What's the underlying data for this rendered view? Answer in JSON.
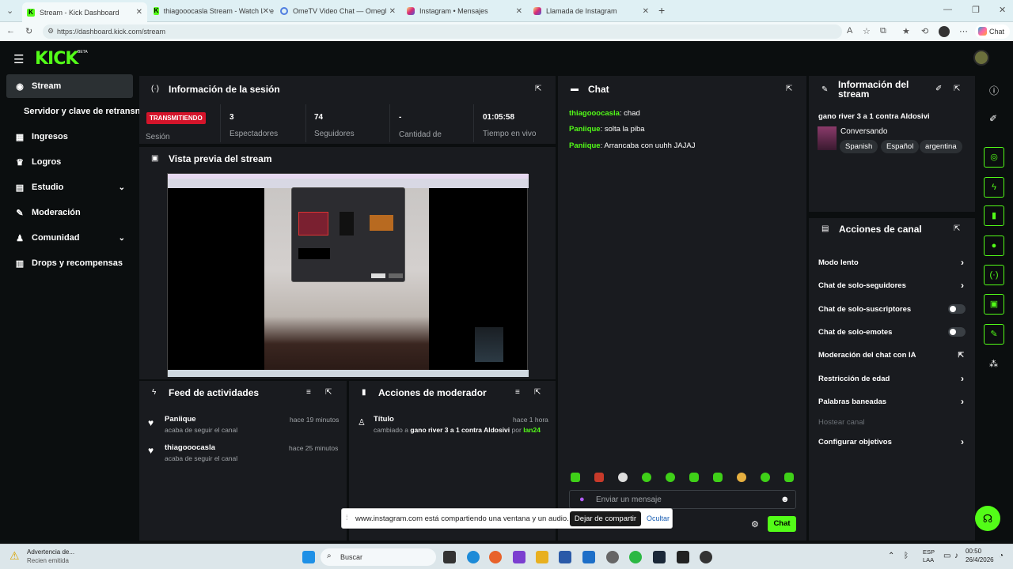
{
  "browser": {
    "tabs": [
      {
        "label": "Stream - Kick Dashboard"
      },
      {
        "label": "thiagooocasla Stream - Watch Live"
      },
      {
        "label": "OmeTV Video Chat — Omegl"
      },
      {
        "label": "Instagram • Mensajes"
      },
      {
        "label": "Llamada de Instagram"
      }
    ],
    "url": "https://dashboard.kick.com/stream",
    "chat_button": "Chat"
  },
  "app": {
    "logo": "KICK",
    "logo_tag": "BETA"
  },
  "sidebar": {
    "items": [
      {
        "label": "Stream"
      },
      {
        "label": "Servidor y clave de retransn"
      },
      {
        "label": "Ingresos"
      },
      {
        "label": "Logros"
      },
      {
        "label": "Estudio"
      },
      {
        "label": "Moderación"
      },
      {
        "label": "Comunidad"
      },
      {
        "label": "Drops y recompensas"
      }
    ]
  },
  "session": {
    "title": "Información de la sesión",
    "status": "TRANSMITIENDO",
    "session_label": "Sesión",
    "stats": [
      {
        "value": "3",
        "label": "Espectadores"
      },
      {
        "value": "74",
        "label": "Seguidores"
      },
      {
        "value": "-",
        "label": "Cantidad de suscripciones"
      },
      {
        "value": "01:05:58",
        "label": "Tiempo en vivo"
      }
    ]
  },
  "preview": {
    "title": "Vista previa del stream"
  },
  "chat": {
    "title": "Chat",
    "messages": [
      {
        "user": "thiagooocasla",
        "text": "chad"
      },
      {
        "user": "Paniique",
        "text": "solta la piba"
      },
      {
        "user": "Paniique",
        "text": "Arrancaba con uuhh JAJAJ"
      }
    ],
    "input_placeholder": "Enviar un mensaje",
    "send_label": "Chat"
  },
  "stream_info": {
    "title": "Información del stream",
    "stream_title": "gano river 3 a 1 contra Aldosivi",
    "category": "Conversando",
    "tags": [
      "Spanish",
      "Español",
      "argentina"
    ]
  },
  "channel_actions": {
    "title": "Acciones de canal",
    "items": [
      {
        "label": "Modo lento"
      },
      {
        "label": "Chat de solo-seguidores"
      },
      {
        "label": "Chat de solo-suscriptores"
      },
      {
        "label": "Chat de solo-emotes"
      },
      {
        "label": "Moderación del chat con IA"
      },
      {
        "label": "Restricción de edad"
      },
      {
        "label": "Palabras baneadas"
      },
      {
        "label": "Hostear canal"
      },
      {
        "label": "Configurar objetivos"
      }
    ]
  },
  "activity": {
    "title": "Feed de actividades",
    "items": [
      {
        "user": "Paniique",
        "action": "acaba de seguir el canal",
        "time": "hace 19 minutos"
      },
      {
        "user": "thiagooocasla",
        "action": "acaba de seguir el canal",
        "time": "hace 25 minutos"
      }
    ]
  },
  "mod_actions": {
    "title": "Acciones de moderador",
    "item": {
      "label": "Título",
      "time": "hace 1 hora",
      "prefix": "cambiado a",
      "value": "gano river 3 a 1 contra Aldosivi",
      "by": "por",
      "user": "lan24"
    }
  },
  "share_bar": {
    "text": "www.instagram.com está compartiendo una ventana y un audio.",
    "stop": "Dejar de compartir",
    "hide": "Ocultar"
  },
  "taskbar": {
    "warning_title": "Advertencia de...",
    "warning_sub": "Recien emitida",
    "search": "Buscar",
    "lang1": "ESP",
    "lang2": "LAA",
    "time": "00:50",
    "date": "26/4/2026"
  }
}
